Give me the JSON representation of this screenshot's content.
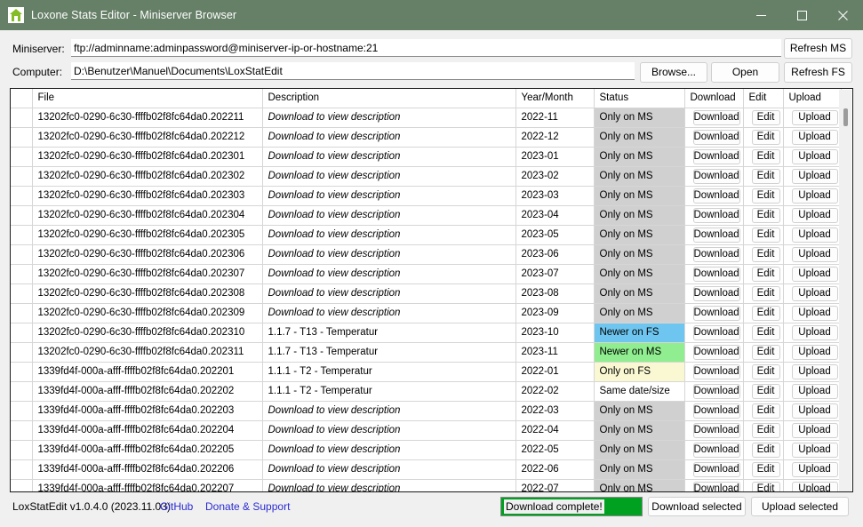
{
  "window": {
    "title": "Loxone Stats Editor - Miniserver Browser",
    "icon": "loxone-house-icon",
    "titlebar_color": "#667f67",
    "controls": {
      "minimize": "minimize-icon",
      "maximize": "maximize-icon",
      "close": "close-icon"
    }
  },
  "form": {
    "miniserver_label": "Miniserver:",
    "miniserver_value": "ftp://adminname:adminpassword@miniserver-ip-or-hostname:21",
    "computer_label": "Computer:",
    "computer_value": "D:\\Benutzer\\Manuel\\Documents\\LoxStatEdit",
    "refresh_ms_label": "Refresh MS",
    "browse_label": "Browse...",
    "open_label": "Open",
    "refresh_fs_label": "Refresh FS"
  },
  "grid": {
    "columns": [
      "File",
      "Description",
      "Year/Month",
      "Status",
      "Download",
      "Edit",
      "Upload"
    ],
    "selected_column": "Description",
    "selected_column_color": "#b9dcf4",
    "status_colors": {
      "Only on MS": "#d0d0d0",
      "Only on FS": "#faf8d2",
      "Newer on FS": "#6ec6f0",
      "Newer on MS": "#90ee90",
      "Same date/size": "#ffffff"
    },
    "placeholder_description": "Download to view description",
    "download_label": "Download",
    "edit_label": "Edit",
    "upload_label": "Upload",
    "rows": [
      {
        "file": "13202fc0-0290-6c30-ffffb02f8fc64da0.202211",
        "description": "Download to view description",
        "italic": true,
        "yearmonth": "2022-11",
        "status": "Only on MS",
        "status_class": "st-ms"
      },
      {
        "file": "13202fc0-0290-6c30-ffffb02f8fc64da0.202212",
        "description": "Download to view description",
        "italic": true,
        "yearmonth": "2022-12",
        "status": "Only on MS",
        "status_class": "st-ms"
      },
      {
        "file": "13202fc0-0290-6c30-ffffb02f8fc64da0.202301",
        "description": "Download to view description",
        "italic": true,
        "yearmonth": "2023-01",
        "status": "Only on MS",
        "status_class": "st-ms"
      },
      {
        "file": "13202fc0-0290-6c30-ffffb02f8fc64da0.202302",
        "description": "Download to view description",
        "italic": true,
        "yearmonth": "2023-02",
        "status": "Only on MS",
        "status_class": "st-ms"
      },
      {
        "file": "13202fc0-0290-6c30-ffffb02f8fc64da0.202303",
        "description": "Download to view description",
        "italic": true,
        "yearmonth": "2023-03",
        "status": "Only on MS",
        "status_class": "st-ms"
      },
      {
        "file": "13202fc0-0290-6c30-ffffb02f8fc64da0.202304",
        "description": "Download to view description",
        "italic": true,
        "yearmonth": "2023-04",
        "status": "Only on MS",
        "status_class": "st-ms"
      },
      {
        "file": "13202fc0-0290-6c30-ffffb02f8fc64da0.202305",
        "description": "Download to view description",
        "italic": true,
        "yearmonth": "2023-05",
        "status": "Only on MS",
        "status_class": "st-ms"
      },
      {
        "file": "13202fc0-0290-6c30-ffffb02f8fc64da0.202306",
        "description": "Download to view description",
        "italic": true,
        "yearmonth": "2023-06",
        "status": "Only on MS",
        "status_class": "st-ms"
      },
      {
        "file": "13202fc0-0290-6c30-ffffb02f8fc64da0.202307",
        "description": "Download to view description",
        "italic": true,
        "yearmonth": "2023-07",
        "status": "Only on MS",
        "status_class": "st-ms"
      },
      {
        "file": "13202fc0-0290-6c30-ffffb02f8fc64da0.202308",
        "description": "Download to view description",
        "italic": true,
        "yearmonth": "2023-08",
        "status": "Only on MS",
        "status_class": "st-ms"
      },
      {
        "file": "13202fc0-0290-6c30-ffffb02f8fc64da0.202309",
        "description": "Download to view description",
        "italic": true,
        "yearmonth": "2023-09",
        "status": "Only on MS",
        "status_class": "st-ms"
      },
      {
        "file": "13202fc0-0290-6c30-ffffb02f8fc64da0.202310",
        "description": "1.1.7 - T13 - Temperatur",
        "italic": false,
        "yearmonth": "2023-10",
        "status": "Newer on FS",
        "status_class": "st-nfs"
      },
      {
        "file": "13202fc0-0290-6c30-ffffb02f8fc64da0.202311",
        "description": "1.1.7 - T13 - Temperatur",
        "italic": false,
        "yearmonth": "2023-11",
        "status": "Newer on MS",
        "status_class": "st-nms"
      },
      {
        "file": "1339fd4f-000a-afff-ffffb02f8fc64da0.202201",
        "description": "1.1.1 - T2 - Temperatur",
        "italic": false,
        "yearmonth": "2022-01",
        "status": "Only on FS",
        "status_class": "st-fs"
      },
      {
        "file": "1339fd4f-000a-afff-ffffb02f8fc64da0.202202",
        "description": "1.1.1 - T2 - Temperatur",
        "italic": false,
        "yearmonth": "2022-02",
        "status": "Same date/size",
        "status_class": "st-same"
      },
      {
        "file": "1339fd4f-000a-afff-ffffb02f8fc64da0.202203",
        "description": "Download to view description",
        "italic": true,
        "yearmonth": "2022-03",
        "status": "Only on MS",
        "status_class": "st-ms"
      },
      {
        "file": "1339fd4f-000a-afff-ffffb02f8fc64da0.202204",
        "description": "Download to view description",
        "italic": true,
        "yearmonth": "2022-04",
        "status": "Only on MS",
        "status_class": "st-ms"
      },
      {
        "file": "1339fd4f-000a-afff-ffffb02f8fc64da0.202205",
        "description": "Download to view description",
        "italic": true,
        "yearmonth": "2022-05",
        "status": "Only on MS",
        "status_class": "st-ms"
      },
      {
        "file": "1339fd4f-000a-afff-ffffb02f8fc64da0.202206",
        "description": "Download to view description",
        "italic": true,
        "yearmonth": "2022-06",
        "status": "Only on MS",
        "status_class": "st-ms"
      },
      {
        "file": "1339fd4f-000a-afff-ffffb02f8fc64da0.202207",
        "description": "Download to view description",
        "italic": true,
        "yearmonth": "2022-07",
        "status": "Only on MS",
        "status_class": "st-ms"
      }
    ]
  },
  "statusbar": {
    "version": "LoxStatEdit v1.0.4.0 (2023.11.03)",
    "github_link": "GitHub",
    "donate_link": "Donate & Support",
    "progress_text": "Download complete!",
    "progress_color": "#00a020",
    "progress_percent": 100,
    "download_selected_label": "Download selected",
    "upload_selected_label": "Upload selected"
  }
}
